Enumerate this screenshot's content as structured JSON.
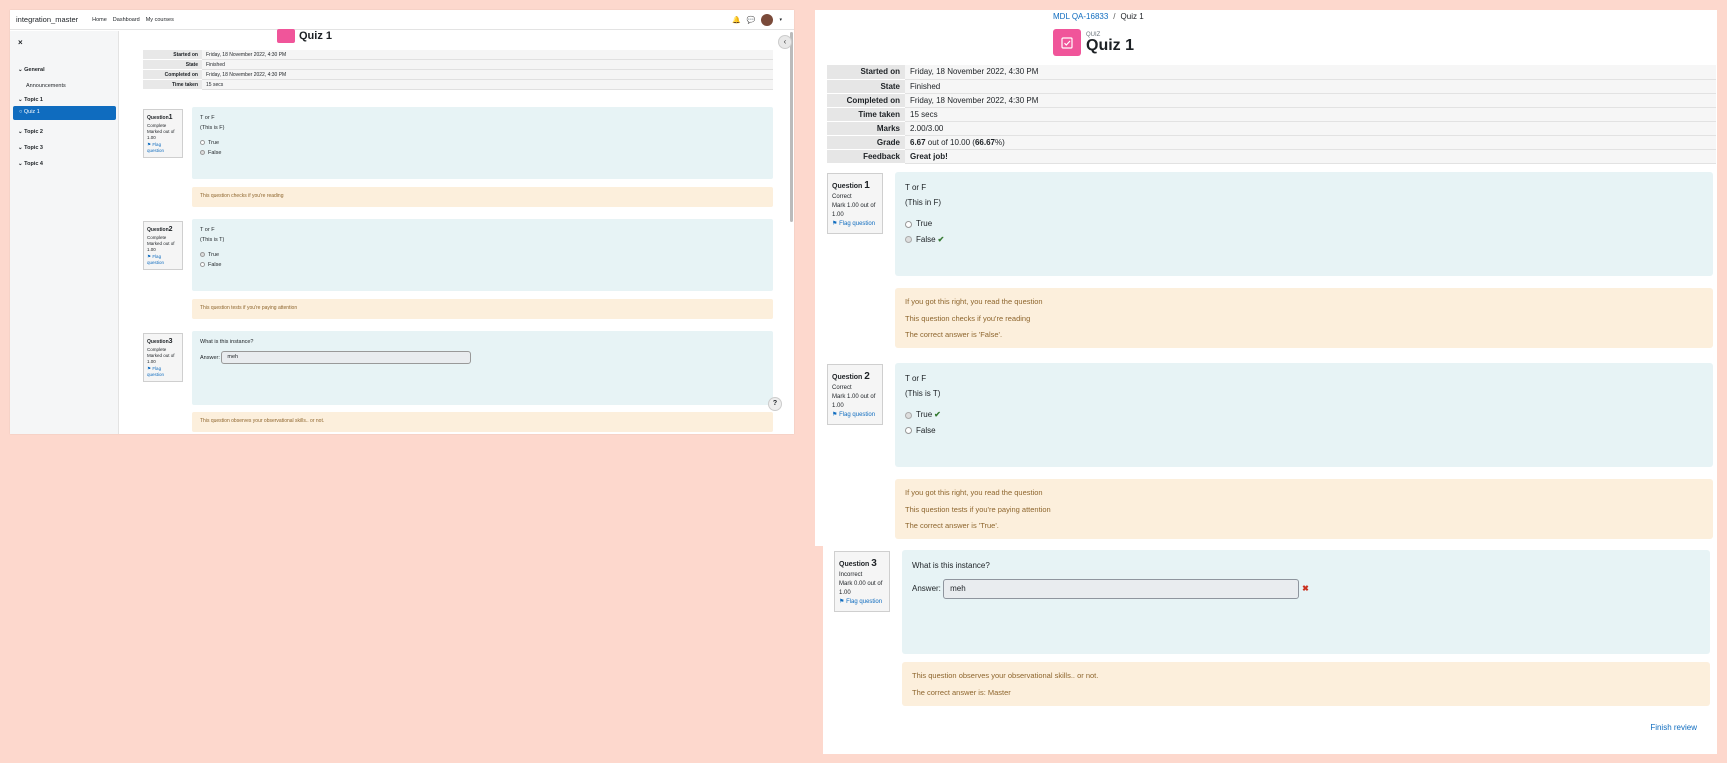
{
  "left": {
    "navbar": {
      "brand": "integration_master",
      "links": [
        "Home",
        "Dashboard",
        "My courses"
      ]
    },
    "drawer": {
      "close": "×",
      "sections": [
        {
          "label": "General"
        },
        {
          "label": "Announcements"
        },
        {
          "label": "Topic 1"
        },
        {
          "label": "Quiz 1"
        },
        {
          "label": "Topic 2"
        },
        {
          "label": "Topic 3"
        },
        {
          "label": "Topic 4"
        }
      ]
    },
    "title": "Quiz 1",
    "summary": [
      {
        "label": "Started on",
        "value": "Friday, 18 November 2022, 4:30 PM"
      },
      {
        "label": "State",
        "value": "Finished"
      },
      {
        "label": "Completed on",
        "value": "Friday, 18 November 2022, 4:30 PM"
      },
      {
        "label": "Time taken",
        "value": "15 secs"
      }
    ],
    "questions": [
      {
        "prefix": "Question",
        "num": "1",
        "status": "Complete",
        "mark": "Marked out of 1.00",
        "flag": "Flag question",
        "text1": "T or F",
        "text2": "(This is F)",
        "opt1": "True",
        "opt2": "False",
        "feedback": "This question checks if you're reading"
      },
      {
        "prefix": "Question",
        "num": "2",
        "status": "Complete",
        "mark": "Marked out of 1.00",
        "flag": "Flag question",
        "text1": "T or F",
        "text2": "(This is T)",
        "opt1": "True",
        "opt2": "False",
        "feedback": "This question tests if you're paying attention"
      },
      {
        "prefix": "Question",
        "num": "3",
        "status": "Complete",
        "mark": "Marked out of 1.00",
        "flag": "Flag question",
        "text1": "What is this instance?",
        "answer_label": "Answer:",
        "answer": "meh",
        "feedback": "This question observes your observational skills.. or not."
      }
    ],
    "help": "?"
  },
  "right": {
    "breadcrumb": {
      "course": "MDL QA-16833",
      "sep": "/",
      "current": "Quiz 1"
    },
    "kind": "QUIZ",
    "title": "Quiz 1",
    "summary": [
      {
        "label": "Started on",
        "value": "Friday, 18 November 2022, 4:30 PM"
      },
      {
        "label": "State",
        "value": "Finished"
      },
      {
        "label": "Completed on",
        "value": "Friday, 18 November 2022, 4:30 PM"
      },
      {
        "label": "Time taken",
        "value": "15 secs"
      },
      {
        "label": "Marks",
        "value": "2.00/3.00"
      },
      {
        "label": "Grade",
        "value_bold1": "6.67",
        "value_mid": " out of 10.00 (",
        "value_bold2": "66.67",
        "value_end": "%)"
      },
      {
        "label": "Feedback",
        "value": "Great job!"
      }
    ],
    "questions": [
      {
        "prefix": "Question",
        "num": "1",
        "status": "Correct",
        "mark": "Mark 1.00 out of 1.00",
        "flag": "Flag question",
        "text1": "T or F",
        "text2": "(This in F)",
        "opt1": "True",
        "opt2": "False",
        "fb1": "If you got this right, you read the question",
        "fb2": "This question checks if you're reading",
        "fb3": "The correct answer is 'False'."
      },
      {
        "prefix": "Question",
        "num": "2",
        "status": "Correct",
        "mark": "Mark 1.00 out of 1.00",
        "flag": "Flag question",
        "text1": "T or F",
        "text2": "(This is T)",
        "opt1": "True",
        "opt2": "False",
        "fb1": "If you got this right, you read the question",
        "fb2": "This question tests if you're paying attention",
        "fb3": "The correct answer is 'True'."
      },
      {
        "prefix": "Question",
        "num": "3",
        "status": "Incorrect",
        "mark": "Mark 0.00 out of 1.00",
        "flag": "Flag question",
        "text1": "What is this instance?",
        "answer_label": "Answer:",
        "answer": "meh",
        "fb1": "This question observes your observational skills.. or not.",
        "fb2": "The correct answer is: Master"
      }
    ],
    "finish": "Finish review"
  },
  "colors": {
    "accent": "#0f6cbf",
    "quiz_icon": "#f0559a",
    "question_bg": "#e7f3f5",
    "feedback_bg": "#fcefdc",
    "correct": "#357a32",
    "incorrect": "#ca3120"
  }
}
